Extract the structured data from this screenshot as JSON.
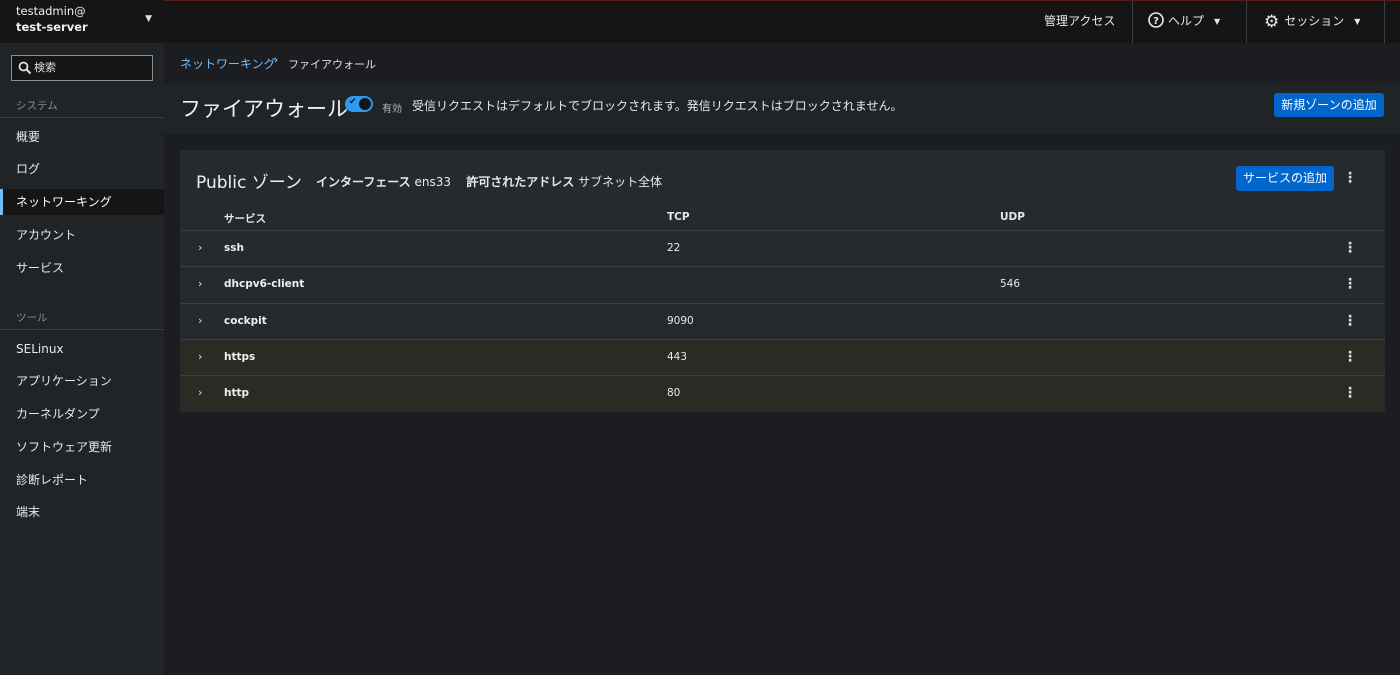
{
  "host": {
    "user": "testadmin@",
    "server": "test-server"
  },
  "search": {
    "placeholder": "検索"
  },
  "sidebar": {
    "system_label": "システム",
    "system_items": [
      "概要",
      "ログ",
      "ネットワーキング",
      "アカウント",
      "サービス"
    ],
    "active_item": "ネットワーキング",
    "tools_label": "ツール",
    "tools_items": [
      "SELinux",
      "アプリケーション",
      "カーネルダンプ",
      "ソフトウェア更新",
      "診断レポート",
      "端末"
    ]
  },
  "topbar": {
    "admin_access": "管理アクセス",
    "help": "ヘルプ",
    "session": "セッション"
  },
  "breadcrumb": {
    "parent": "ネットワーキング",
    "current": "ファイアウォール"
  },
  "header": {
    "title": "ファイアウォール",
    "toggle_label": "有効",
    "toggle_on": true,
    "description": "受信リクエストはデフォルトでブロックされます。発信リクエストはブロックされません。",
    "add_zone_button": "新規ゾーンの追加"
  },
  "zone": {
    "title": "Public ゾーン",
    "interface_label": "インターフェース",
    "interface_value": "ens33",
    "allowed_label": "許可されたアドレス",
    "allowed_value": "サブネット全体",
    "add_service_button": "サービスの追加",
    "columns": {
      "service": "サービス",
      "tcp": "TCP",
      "udp": "UDP"
    },
    "rows": [
      {
        "service": "ssh",
        "tcp": "22",
        "udp": ""
      },
      {
        "service": "dhcpv6-client",
        "tcp": "",
        "udp": "546"
      },
      {
        "service": "cockpit",
        "tcp": "9090",
        "udp": ""
      },
      {
        "service": "https",
        "tcp": "443",
        "udp": ""
      },
      {
        "service": "http",
        "tcp": "80",
        "udp": ""
      }
    ]
  },
  "colors": {
    "accent": "#0066cc",
    "link": "#73bcf7",
    "toggle": "#2b9af3"
  }
}
